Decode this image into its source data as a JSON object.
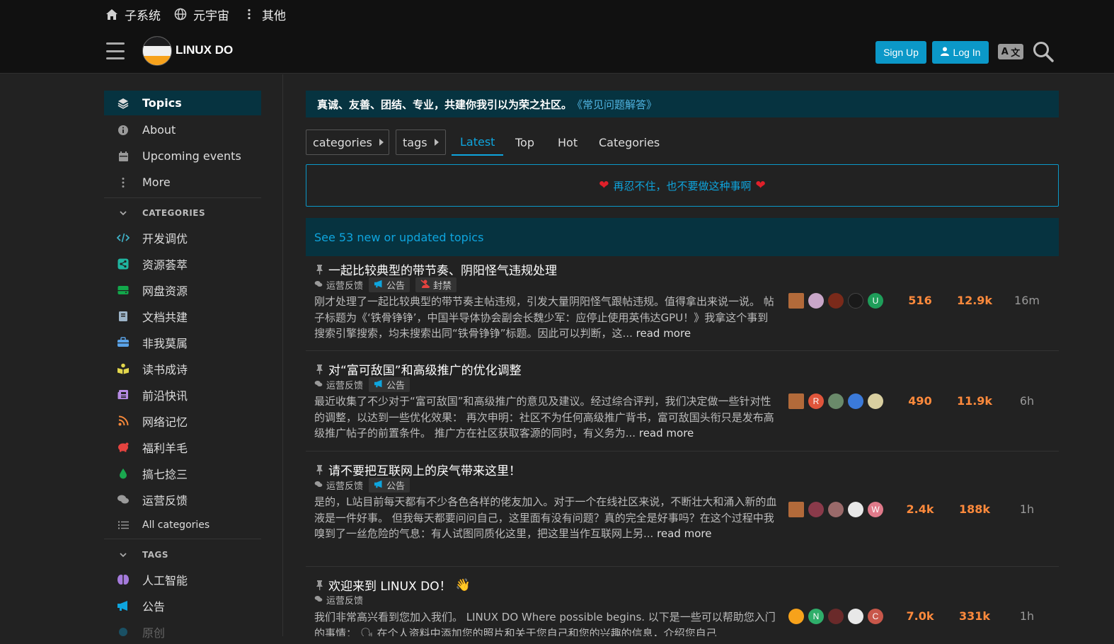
{
  "topnav": {
    "items": [
      {
        "label": "子系统",
        "icon": "home-icon"
      },
      {
        "label": "元宇宙",
        "icon": "globe-icon"
      },
      {
        "label": "其他",
        "icon": "more-vertical-icon"
      }
    ]
  },
  "header": {
    "brand": "LINUX DO",
    "signup": "Sign Up",
    "login": "Log In"
  },
  "sidebar": {
    "main": [
      {
        "label": "Topics",
        "icon": "layers-icon"
      },
      {
        "label": "About",
        "icon": "info-icon"
      },
      {
        "label": "Upcoming events",
        "icon": "calendar-icon"
      },
      {
        "label": "More",
        "icon": "more-vertical-icon"
      }
    ],
    "categories_heading": "CATEGORIES",
    "categories": [
      {
        "label": "开发调优",
        "icon": "code-icon",
        "color": "#3fb1c7"
      },
      {
        "label": "资源荟萃",
        "icon": "share-icon",
        "color": "#1fb5a0"
      },
      {
        "label": "网盘资源",
        "icon": "hard-drive-icon",
        "color": "#12a84b"
      },
      {
        "label": "文档共建",
        "icon": "book-icon",
        "color": "#9db4c8"
      },
      {
        "label": "非我莫属",
        "icon": "briefcase-icon",
        "color": "#5aa3e8"
      },
      {
        "label": "读书成诗",
        "icon": "book-open-icon",
        "color": "#e3d74c"
      },
      {
        "label": "前沿快讯",
        "icon": "newspaper-icon",
        "color": "#b68be4"
      },
      {
        "label": "网络记忆",
        "icon": "rss-icon",
        "color": "#f5883a"
      },
      {
        "label": "福利羊毛",
        "icon": "piggy-bank-icon",
        "color": "#e5433f"
      },
      {
        "label": "搞七捻三",
        "icon": "droplet-icon",
        "color": "#1aa84f"
      },
      {
        "label": "运营反馈",
        "icon": "comments-icon",
        "color": "#9a9a9a"
      }
    ],
    "all_categories": "All categories",
    "tags_heading": "TAGS",
    "tags": [
      {
        "label": "人工智能",
        "icon": "brain-icon",
        "color": "#a57bdc"
      },
      {
        "label": "公告",
        "icon": "megaphone-icon",
        "color": "#0ea5de"
      },
      {
        "label": "原创",
        "icon": "tag-icon",
        "color": "#0ea5de"
      }
    ]
  },
  "banner": {
    "text": "真诚、友善、团结、专业，共建你我引以为荣之社区。",
    "faq": "《常见问题解答》"
  },
  "filters": {
    "categories": "categories",
    "tags": "tags"
  },
  "navtabs": [
    "Latest",
    "Top",
    "Hot",
    "Categories"
  ],
  "notice": {
    "text": "再忍不住，也不要做这种事啊"
  },
  "new_topics": "See 53 new or updated topics",
  "topics": [
    {
      "title": "一起比较典型的带节奏、阴阳怪气违规处理",
      "category": "运营反馈",
      "tags": [
        {
          "label": "公告",
          "icon": "megaphone-icon"
        },
        {
          "label": "封禁",
          "icon": "ban-icon"
        }
      ],
      "excerpt": "刚才处理了一起比较典型的带节奏主帖违规，引发大量阴阳怪气跟帖违规。值得拿出来说一说。 帖子标题为《‘铁骨铮铮’，中国半导体协会副会长魏少军：应停止使用英伟达GPU！》我拿这个事到搜索引擎搜索，均未搜索出同“铁骨铮铮”标题。因此可以判断，这...",
      "read_more": "read more",
      "avatars": [
        {
          "letter": "",
          "color": "#b26a3a"
        },
        {
          "letter": "",
          "color": "#c8a6c8"
        },
        {
          "letter": "",
          "color": "#7a2a1a"
        },
        {
          "letter": "",
          "color": "#1a1a1a"
        },
        {
          "letter": "U",
          "color": "#1e9e5a"
        }
      ],
      "replies": "516",
      "views": "12.9k",
      "age": "16m"
    },
    {
      "title": "对“富可敌国”和高级推广的优化调整",
      "category": "运营反馈",
      "tags": [
        {
          "label": "公告",
          "icon": "megaphone-icon"
        }
      ],
      "excerpt": "最近收集了不少对于“富可敌国”和高级推广的意见及建议。经过综合评判，我们决定做一些针对性的调整，以达到一些优化效果： 再次申明：社区不为任何高级推广背书，富可敌国头衔只是发布高级推广帖子的前置条件。 推广方在社区获取客源的同时，有义务为...",
      "read_more": "read more",
      "avatars": [
        {
          "letter": "",
          "color": "#b26a3a"
        },
        {
          "letter": "R",
          "color": "#e0553b"
        },
        {
          "letter": "",
          "color": "#6a8a6a"
        },
        {
          "letter": "",
          "color": "#3b7ad9"
        },
        {
          "letter": "",
          "color": "#d9cfa0"
        }
      ],
      "replies": "490",
      "views": "11.9k",
      "age": "6h"
    },
    {
      "title": "请不要把互联网上的戾气带来这里！",
      "category": "运营反馈",
      "tags": [
        {
          "label": "公告",
          "icon": "megaphone-icon"
        }
      ],
      "excerpt": "是的，L站目前每天都有不少各色各样的佬友加入。对于一个在线社区来说，不断壮大和涌入新的血液是一件好事。 但我每天都要问问自己，这里面有没有问题？真的完全是好事吗？在这个过程中我嗅到了一丝危险的气息：有人试图同质化这里，把这里当作互联网上另...",
      "read_more": "read more",
      "avatars": [
        {
          "letter": "",
          "color": "#b26a3a"
        },
        {
          "letter": "",
          "color": "#8a3a4a"
        },
        {
          "letter": "",
          "color": "#9a6a6a"
        },
        {
          "letter": "",
          "color": "#e8e8e8"
        },
        {
          "letter": "W",
          "color": "#e07a8a"
        }
      ],
      "replies": "2.4k",
      "views": "188k",
      "age": "1h"
    },
    {
      "title": "欢迎来到 LINUX DO！",
      "emoji": "👋",
      "category": "运营反馈",
      "tags": [],
      "excerpt": "我们非常高兴看到您加入我们。 LINUX DO Where possible begins. 以下是一些可以帮助您入门的事情： 🗣 在个人资料中添加您的照片和关于您自己和您的兴趣的信息，介绍您自己",
      "read_more": "",
      "avatars": [
        {
          "letter": "",
          "color": "#f7a21b"
        },
        {
          "letter": "N",
          "color": "#2fae6a"
        },
        {
          "letter": "",
          "color": "#6a2a2a"
        },
        {
          "letter": "",
          "color": "#e8e8e8"
        },
        {
          "letter": "C",
          "color": "#c8574a"
        }
      ],
      "replies": "7.0k",
      "views": "331k",
      "age": "1h"
    }
  ]
}
